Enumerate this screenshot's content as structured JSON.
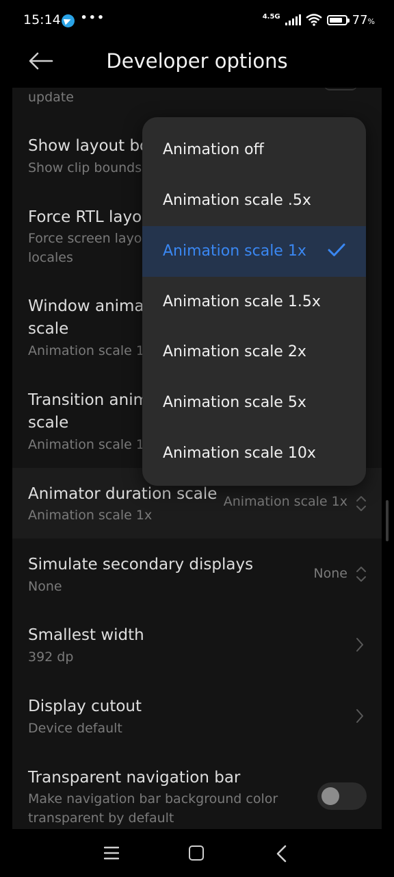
{
  "status_bar": {
    "time": "15:14",
    "network": "4.5G",
    "battery": "77",
    "battery_unit": "%",
    "battery_level": 0.77,
    "icons": [
      "telegram-icon",
      "more-dots-icon",
      "signal-icon",
      "wifi-icon",
      "battery-icon"
    ]
  },
  "app_bar": {
    "title": "Developer options",
    "back_icon": "back-arrow-icon"
  },
  "settings": [
    {
      "id": "partial-top",
      "subtitle": "update"
    },
    {
      "id": "show-layout-bounds",
      "title": "Show layout bo",
      "subtitle": "Show clip bounds"
    },
    {
      "id": "force-rtl",
      "title": "Force RTL layo",
      "subtitle_line1": "Force screen layo",
      "subtitle_line2": "locales"
    },
    {
      "id": "window-animation-scale",
      "title_line1": "Window anima",
      "title_line2": "scale",
      "subtitle": "Animation scale 1x"
    },
    {
      "id": "transition-animation-scale",
      "title_line1": "Transition anim",
      "title_line2": "scale",
      "subtitle": "Animation scale 1x"
    },
    {
      "id": "animator-duration-scale",
      "title": "Animator duration scale",
      "subtitle": "Animation scale 1x",
      "value": "Animation scale 1x"
    },
    {
      "id": "simulate-secondary-displays",
      "title": "Simulate secondary displays",
      "subtitle": "None",
      "value": "None"
    },
    {
      "id": "smallest-width",
      "title": "Smallest width",
      "subtitle": "392 dp"
    },
    {
      "id": "display-cutout",
      "title": "Display cutout",
      "subtitle": "Device default"
    },
    {
      "id": "transparent-nav-bar",
      "title": "Transparent navigation bar",
      "subtitle_line1": "Make navigation bar background color",
      "subtitle_line2": "transparent by default",
      "toggle_on": false
    }
  ],
  "popup": {
    "options": [
      "Animation off",
      "Animation scale .5x",
      "Animation scale 1x",
      "Animation scale 1.5x",
      "Animation scale 2x",
      "Animation scale 5x",
      "Animation scale 10x"
    ],
    "selected": "Animation scale 1x",
    "accent_color": "#3a87f2"
  },
  "nav_bar": {
    "icons": [
      "menu-icon",
      "home-icon",
      "back-icon"
    ]
  }
}
